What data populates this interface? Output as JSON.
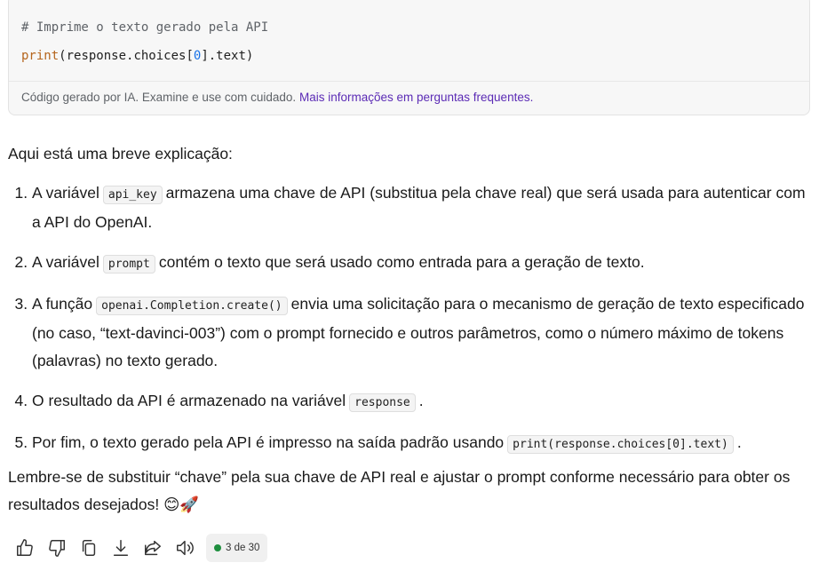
{
  "code_block": {
    "comment": "# Imprime o texto gerado pela API",
    "line_fn": "print",
    "line_part1": "(response.choices[",
    "line_index": "0",
    "line_part2": "].text)",
    "disclaimer": "Código gerado por IA. Examine e use com cuidado.",
    "disclaimer_link": "Mais informações em perguntas frequentes."
  },
  "intro": "Aqui está uma breve explicação:",
  "steps": [
    {
      "before": "A variável",
      "code": "api_key",
      "after": "armazena uma chave de API (substitua pela chave real) que será usada para autenticar com a API do OpenAI."
    },
    {
      "before": "A variável",
      "code": "prompt",
      "after": "contém o texto que será usado como entrada para a geração de texto."
    },
    {
      "before": "A função",
      "code": "openai.Completion.create()",
      "after": "envia uma solicitação para o mecanismo de geração de texto especificado (no caso, “text-davinci-003”) com o prompt fornecido e outros parâmetros, como o número máximo de tokens (palavras) no texto gerado."
    },
    {
      "before": "O resultado da API é armazenado na variável",
      "code": "response",
      "after": "."
    },
    {
      "before": "Por fim, o texto gerado pela API é impresso na saída padrão usando",
      "code": "print(response.choices[0].text)",
      "after": "."
    }
  ],
  "outro": "Lembre-se de substituir “chave” pela sua chave de API real e ajustar o prompt conforme necessário para obter os resultados desejados! 😊🚀",
  "toolbar": {
    "icons": [
      "thumbs-up-icon",
      "thumbs-down-icon",
      "copy-icon",
      "download-icon",
      "share-icon",
      "speaker-icon"
    ],
    "counter": "3 de 30",
    "counter_color": "#1e8e3e"
  }
}
